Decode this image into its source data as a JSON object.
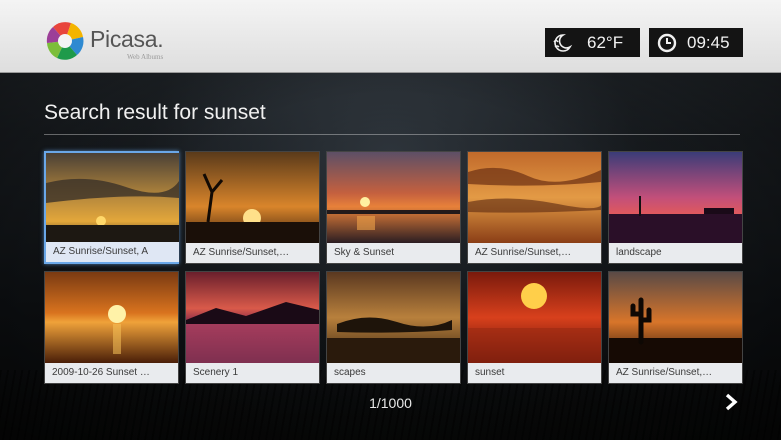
{
  "header": {
    "brand": "Picasa.",
    "brand_sub": "Web Albums",
    "weather_icon": "moon-cloud-icon",
    "temperature": "62°F",
    "clock_icon": "clock-icon",
    "time": "09:45"
  },
  "search": {
    "title": "Search result for sunset"
  },
  "results": [
    {
      "caption": "AZ Sunrise/Sunset, A",
      "selected": true
    },
    {
      "caption": "AZ Sunrise/Sunset,…",
      "selected": false
    },
    {
      "caption": "Sky & Sunset",
      "selected": false
    },
    {
      "caption": "AZ Sunrise/Sunset,…",
      "selected": false
    },
    {
      "caption": "landscape",
      "selected": false
    },
    {
      "caption": "2009-10-26 Sunset …",
      "selected": false
    },
    {
      "caption": "Scenery 1",
      "selected": false
    },
    {
      "caption": "scapes",
      "selected": false
    },
    {
      "caption": "sunset",
      "selected": false
    },
    {
      "caption": "AZ Sunrise/Sunset,…",
      "selected": false
    }
  ],
  "pagination": {
    "page": "1/1000",
    "next_icon": "chevron-right-icon"
  },
  "colors": {
    "selection": "#6aa7e8",
    "caption_bg": "#e9ebee",
    "header_bg": "#efefef"
  }
}
